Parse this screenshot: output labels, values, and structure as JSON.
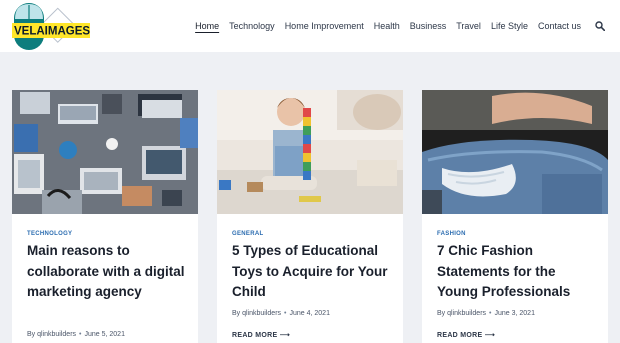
{
  "logo": {
    "text": "VELAIMAGES"
  },
  "nav": {
    "items": [
      "Home",
      "Technology",
      "Home Improvement",
      "Health",
      "Business",
      "Travel",
      "Life Style",
      "Contact us"
    ],
    "active": "Home",
    "search_icon": "search-icon"
  },
  "posts": [
    {
      "category": "TECHNOLOGY",
      "title": "Main reasons to collaborate with a digital marketing agency",
      "author": "By qlinkbuilders",
      "date": "June 5, 2021"
    },
    {
      "category": "GENERAL",
      "title": "5 Types of Educational Toys to Acquire for Your Child",
      "author": "By qlinkbuilders",
      "date": "June 4, 2021",
      "read_more": "READ MORE ⟶"
    },
    {
      "category": "FASHION",
      "title": "7 Chic Fashion Statements for the Young Professionals",
      "author": "By qlinkbuilders",
      "date": "June 3, 2021",
      "read_more": "READ MORE ⟶"
    }
  ],
  "colors": {
    "accent": "#2b6cb0",
    "background": "#eef0f4",
    "logo_yellow": "#ffe62a",
    "logo_teal": "#0f8a8a"
  }
}
